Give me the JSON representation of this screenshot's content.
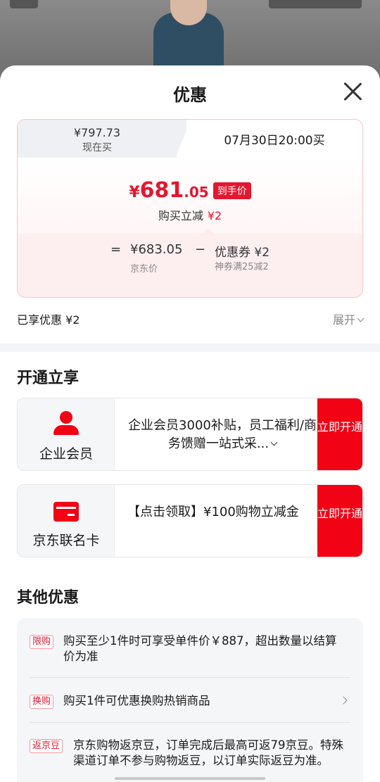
{
  "sheet": {
    "title": "优惠"
  },
  "price_card": {
    "tab_now_price": "¥797.73",
    "tab_now_label": "现在买",
    "tab_later_label": "07月30日20:00买",
    "final_symbol": "¥",
    "final_int": "681",
    "final_dec": ".05",
    "final_tag": "到手价",
    "reduce_label": "购买立减",
    "reduce_value": "¥2",
    "eq_sign": "=",
    "jd_price": "¥683.05",
    "jd_price_label": "京东价",
    "minus_sign": "−",
    "coupon_value": "优惠券 ¥2",
    "coupon_desc": "神券满25减2"
  },
  "summary": {
    "enjoyed": "已享优惠 ¥2",
    "expand": "展开"
  },
  "open_section": {
    "title": "开通立享",
    "items": [
      {
        "name": "企业会员",
        "desc": "企业会员3000补贴，员工福利/商务馈赠一站式采...",
        "button": "立即开通",
        "icon": "person-icon"
      },
      {
        "name": "京东联名卡",
        "desc": "【点击领取】¥100购物立减金",
        "button": "立即开通",
        "icon": "card-icon"
      }
    ]
  },
  "other_section": {
    "title": "其他优惠",
    "items": [
      {
        "tag": "限购",
        "text": "购买至少1件时可享受单件价￥887，超出数量以结算价为准"
      },
      {
        "tag": "换购",
        "text": "购买1件可优惠换购热销商品"
      },
      {
        "tag": "返京豆",
        "text": "京东购物返京豆，订单完成后最高可返79京豆。特殊渠道订单不参与购物返豆，以订单实际返豆为准。"
      }
    ]
  },
  "colors": {
    "accent_red": "#e5162f",
    "button_red": "#f10215"
  }
}
